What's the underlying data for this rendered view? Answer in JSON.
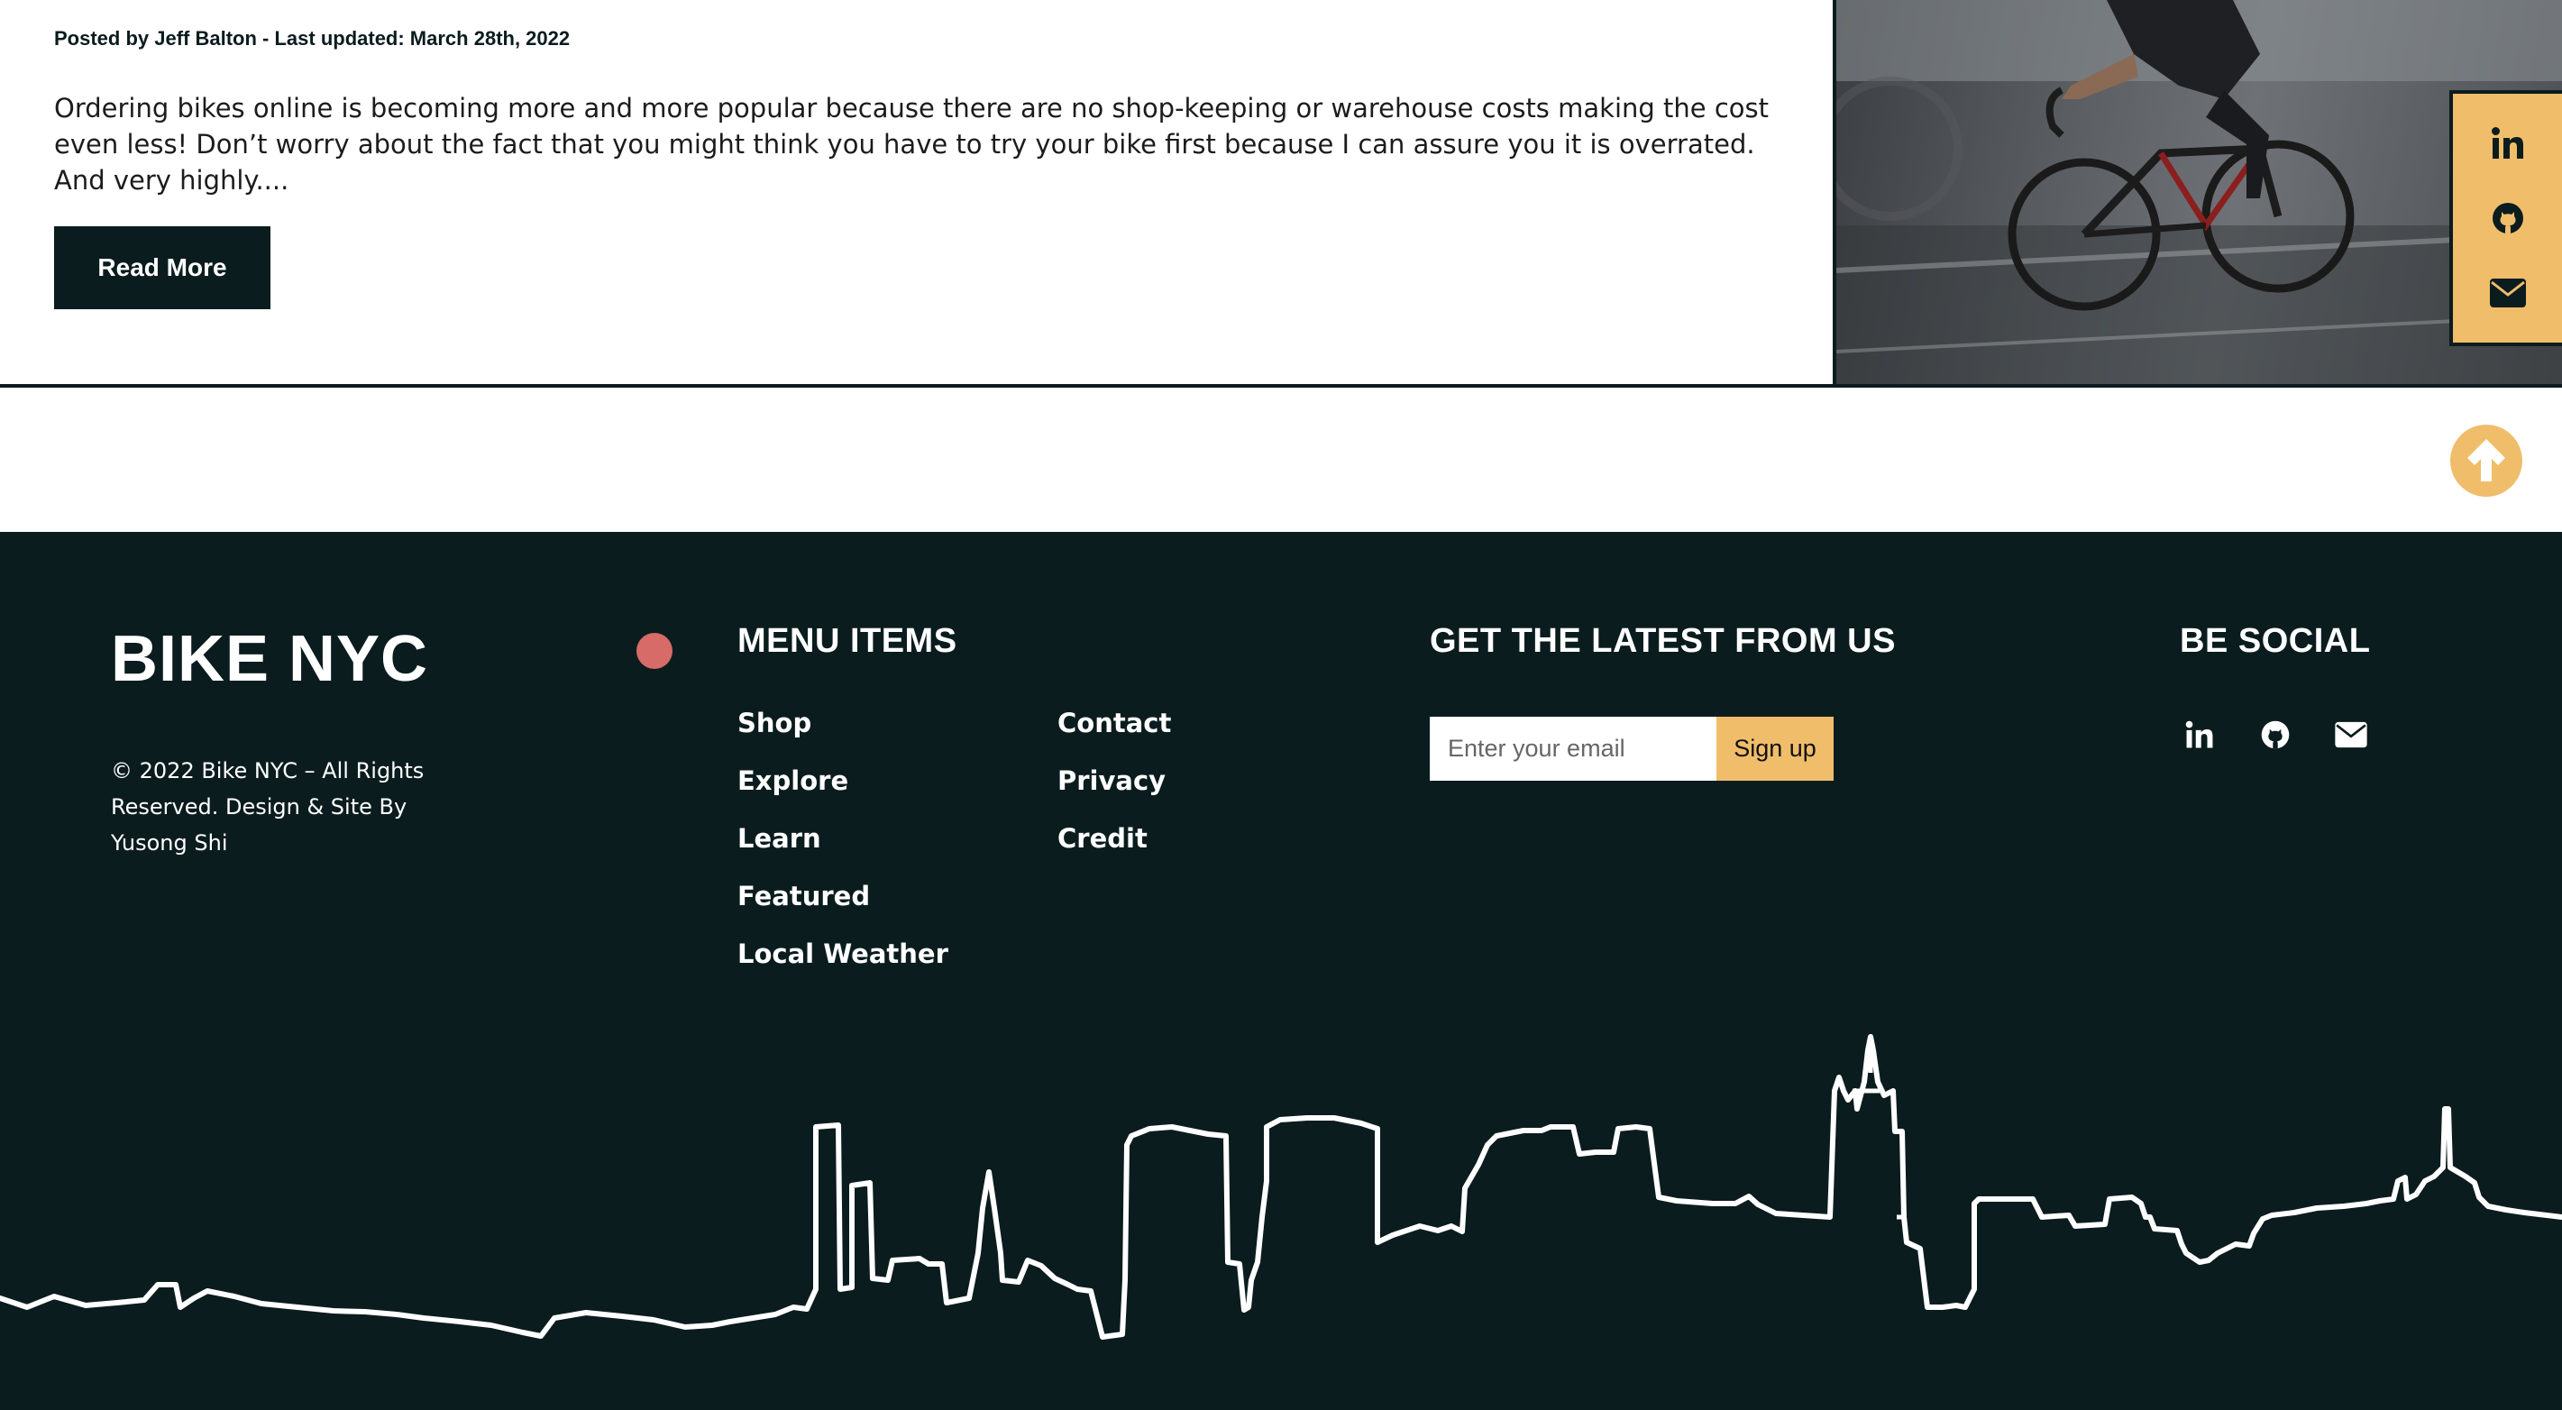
{
  "article": {
    "meta": "Posted by Jeff Balton - Last updated: March 28th, 2022",
    "excerpt": "Ordering bikes online is becoming more and more popular because there are no shop-keeping or warehouse costs making the cost even less! Don’t worry about the fact that you might think you have to try your bike first because I can assure you it is overrated. And very highly....",
    "read_more_label": "Read More",
    "image_icon": "cyclist-photo"
  },
  "floating_social": {
    "icons": [
      "linkedin-icon",
      "github-icon",
      "envelope-icon"
    ]
  },
  "back_to_top_icon": "arrow-up-icon",
  "footer": {
    "brand": "BIKE NYC",
    "copyright": "© 2022 Bike NYC – All Rights Reserved. Design & Site By Yusong Shi",
    "menu_title": "MENU ITEMS",
    "menu_col1": [
      "Shop",
      "Explore",
      "Learn",
      "Featured",
      "Local Weather"
    ],
    "menu_col2": [
      "Contact",
      "Privacy",
      "Credit"
    ],
    "newsletter_title": "GET THE LATEST FROM US",
    "email_placeholder": "Enter your email",
    "signup_label": "Sign up",
    "social_title": "BE SOCIAL",
    "social_icons": [
      "linkedin-icon",
      "github-icon",
      "envelope-icon"
    ]
  },
  "colors": {
    "dark": "#0b1c1f",
    "accent": "#f0bd6a",
    "dot": "#d76b67"
  }
}
